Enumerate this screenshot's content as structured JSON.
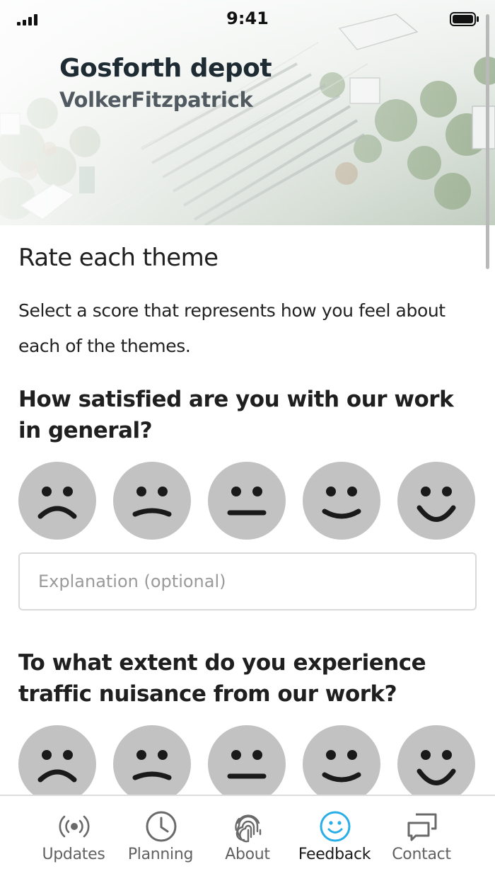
{
  "status_bar": {
    "time": "9:41"
  },
  "header": {
    "title": "Gosforth depot",
    "subtitle": "VolkerFitzpatrick"
  },
  "main": {
    "section_title": "Rate each theme",
    "intro": "Select a score that represents how you feel about each of the themes.",
    "questions": [
      {
        "text": "How satisfied are you with our work in general?",
        "explanation_placeholder": "Explanation (optional)"
      },
      {
        "text": "To what extent do you experience traffic nuisance from our work?"
      }
    ],
    "face_scale": [
      "very-sad",
      "sad",
      "neutral",
      "happy",
      "very-happy"
    ]
  },
  "tabs": [
    {
      "label": "Updates",
      "icon": "broadcast-icon",
      "active": false
    },
    {
      "label": "Planning",
      "icon": "clock-icon",
      "active": false
    },
    {
      "label": "About",
      "icon": "fingerprint-icon",
      "active": false
    },
    {
      "label": "Feedback",
      "icon": "smiley-icon",
      "active": true
    },
    {
      "label": "Contact",
      "icon": "chat-icon",
      "active": false
    }
  ],
  "colors": {
    "accent": "#2aaee8",
    "face_fill": "#c2c2c2",
    "face_features": "#1a1a1a",
    "tab_icon_inactive": "#6a6a6a"
  }
}
